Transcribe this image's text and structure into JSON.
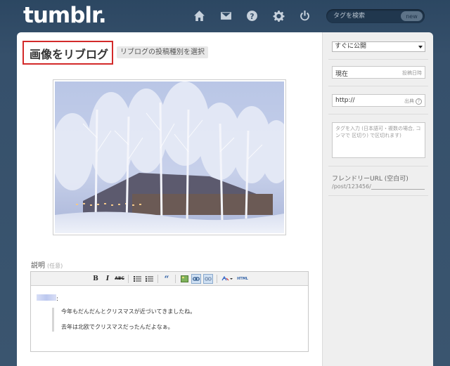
{
  "header": {
    "logo": "tumblr.",
    "search_placeholder": "タグを検索",
    "new_badge": "new",
    "icons": [
      "home-icon",
      "mail-icon",
      "help-icon",
      "gear-icon",
      "power-icon"
    ]
  },
  "post": {
    "title": "画像をリブログ",
    "type_select": "リブログの投稿種別を選択",
    "description_label": "説明",
    "description_optional": "(任意)",
    "body_colon": ":",
    "quote_lines": [
      "今年もだんだんとクリスマスが近づいてきましたね。",
      "去年は北欧でクリスマスだったんだよなぁ。"
    ],
    "toolbar": [
      "B",
      "I",
      "ABC",
      "ul",
      "ol",
      "quote",
      "image",
      "link",
      "unlink",
      "spell",
      "HTML"
    ]
  },
  "sidebar": {
    "publish_select": "すぐに公開",
    "date_value": "現在",
    "date_hint": "投稿日時",
    "source_value": "http://",
    "source_hint": "出典",
    "tags_placeholder": "タグを入力 (日本語可・複数の場合, コンマで 区切り) で区切れます)",
    "friendly_url_label": "フレンドリーURL (空白可)",
    "friendly_url_prefix": "/post/123456/"
  },
  "colors": {
    "bg": "#36506b",
    "highlight": "#d32a2a"
  }
}
